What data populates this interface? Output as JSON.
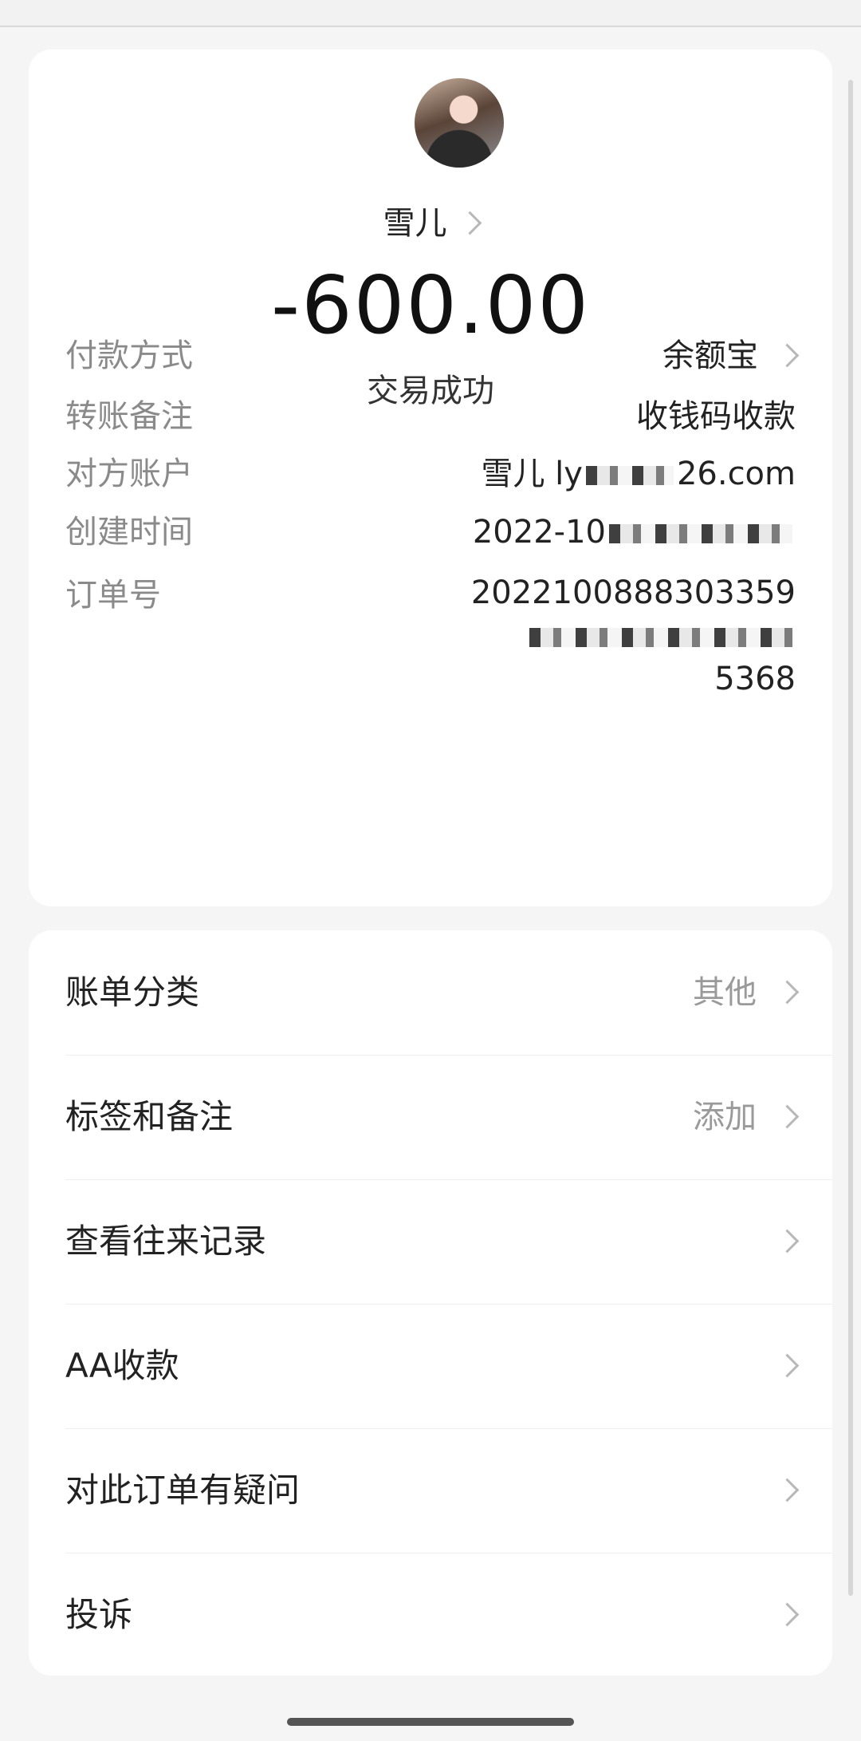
{
  "payee": {
    "name": "雪儿",
    "avatar_icon": "person-avatar-photo"
  },
  "transaction": {
    "amount": "-600.00",
    "status": "交易成功"
  },
  "details": {
    "payment_method_label": "付款方式",
    "payment_method_value": "余额宝",
    "transfer_note_label": "转账备注",
    "transfer_note_value": "收钱码收款",
    "counterparty_label": "对方账户",
    "counterparty_value_start": "雪儿 ly",
    "counterparty_value_end": "26.com",
    "created_label": "创建时间",
    "created_value_start": "2022-10",
    "order_label": "订单号",
    "order_value_start": "2022100888303359",
    "order_value_end": "5368"
  },
  "menu": {
    "items": [
      {
        "label": "账单分类",
        "value": "其他"
      },
      {
        "label": "标签和备注",
        "value": "添加"
      },
      {
        "label": "查看往来记录",
        "value": ""
      },
      {
        "label": "AA收款",
        "value": ""
      },
      {
        "label": "对此订单有疑问",
        "value": ""
      },
      {
        "label": "投诉",
        "value": ""
      }
    ]
  }
}
